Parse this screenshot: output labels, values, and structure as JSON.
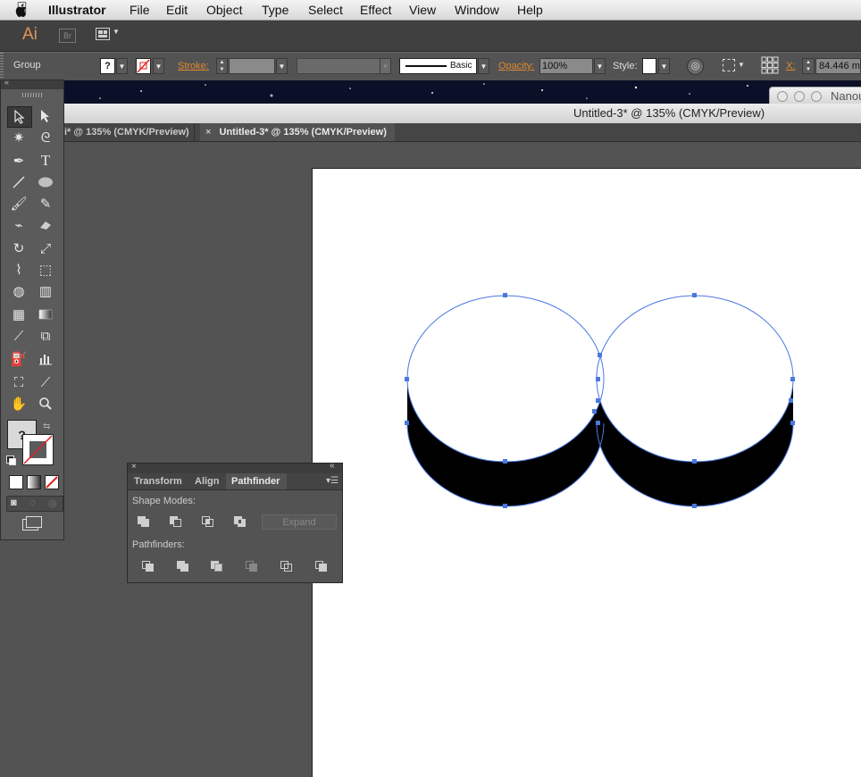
{
  "menubar": {
    "app_name": "Illustrator",
    "items": [
      "File",
      "Edit",
      "Object",
      "Type",
      "Select",
      "Effect",
      "View",
      "Window",
      "Help"
    ]
  },
  "appbar": {
    "ai_logo": "Ai",
    "br_logo": "Br"
  },
  "control_bar": {
    "selection_type": "Group",
    "fill_value": "?",
    "stroke_label": "Stroke:",
    "brush_label": "Basic",
    "opacity_label": "Opacity:",
    "opacity_value": "100%",
    "style_label": "Style:",
    "x_label": "X:",
    "x_value": "84.446 m"
  },
  "floating_window": {
    "title": "Nanou"
  },
  "document": {
    "window_title": "Untitled-3* @ 135% (CMYK/Preview)",
    "tabs": [
      {
        "label": "i* @ 135% (CMYK/Preview)",
        "active": false
      },
      {
        "label": "Untitled-3* @ 135% (CMYK/Preview)",
        "active": true
      }
    ],
    "close_glyph": "×"
  },
  "tools": {
    "fill_placeholder": "?",
    "items": [
      "selection",
      "direct-selection",
      "magic-wand",
      "lasso",
      "pen",
      "type",
      "line",
      "ellipse",
      "paintbrush",
      "pencil",
      "blob-brush",
      "eraser",
      "rotate",
      "scale",
      "width",
      "free-transform",
      "shape-builder",
      "perspective-grid",
      "mesh",
      "gradient",
      "eyedropper",
      "blend",
      "symbol-sprayer",
      "column-graph",
      "artboard",
      "slice",
      "hand",
      "zoom"
    ]
  },
  "pathfinder_panel": {
    "tabs": [
      "Transform",
      "Align",
      "Pathfinder"
    ],
    "active_tab": "Pathfinder",
    "shape_modes_label": "Shape Modes:",
    "expand_label": "Expand",
    "pathfinders_label": "Pathfinders:"
  },
  "colors": {
    "selection_blue": "#4a78e0",
    "accent_orange": "#e08a2e",
    "ai_logo_color": "#e0955a"
  }
}
